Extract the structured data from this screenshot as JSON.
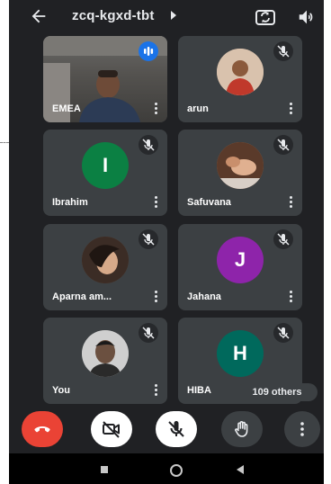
{
  "meeting": {
    "code": "zcq-kgxd-tbt"
  },
  "participants": [
    {
      "name": "EMEA",
      "muted": false,
      "kind": "video"
    },
    {
      "name": "arun",
      "muted": true,
      "kind": "photo"
    },
    {
      "name": "Ibrahim",
      "muted": true,
      "kind": "initial",
      "initial": "I",
      "color": "#0b8043"
    },
    {
      "name": "Safuvana",
      "muted": true,
      "kind": "photo"
    },
    {
      "name": "Aparna am...",
      "muted": true,
      "kind": "photo"
    },
    {
      "name": "Jahana",
      "muted": true,
      "kind": "initial",
      "initial": "J",
      "color": "#8e24aa"
    },
    {
      "name": "You",
      "muted": true,
      "kind": "photo"
    },
    {
      "name": "HIBA",
      "muted": true,
      "kind": "initial",
      "initial": "H",
      "color": "#00695c"
    }
  ],
  "others": {
    "label": "109 others"
  },
  "controls": {
    "end_call_color": "#ea4335",
    "camera": "camera-off-icon",
    "mic": "mic-off-icon",
    "hand": "raise-hand-icon",
    "more": "more-vertical-icon"
  },
  "colors": {
    "background": "#202124",
    "tile": "#3c4043",
    "active_speaker": "#1a73e8"
  }
}
